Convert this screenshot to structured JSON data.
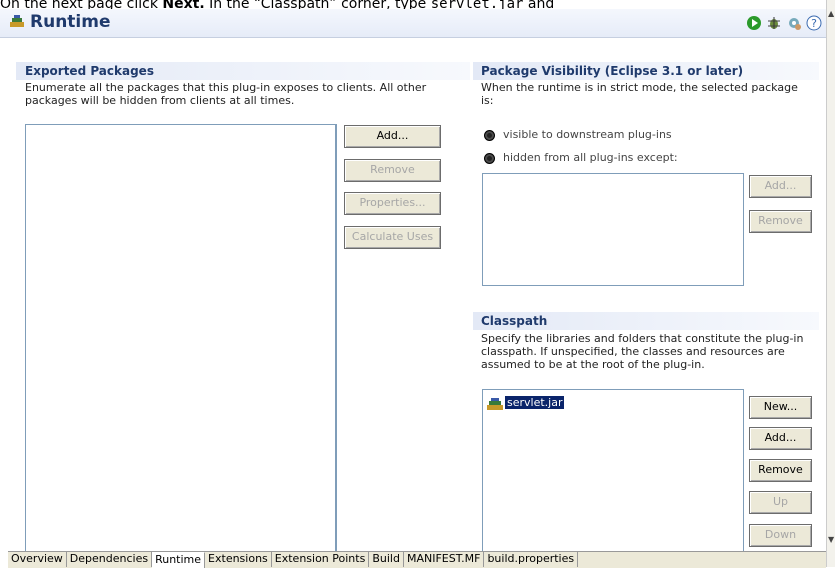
{
  "caption": {
    "prefix": "On the next page click ",
    "bold": "Next.",
    "middle": " In the “Classpath” corner, type ",
    "mono": "servlet.jar",
    "suffix": " and"
  },
  "header": {
    "title": "Runtime",
    "icons": [
      "run-icon",
      "debug-icon",
      "external-tools-icon",
      "help-icon"
    ]
  },
  "exported": {
    "title": "Exported Packages",
    "desc1": "Enumerate all the packages that this plug-in exposes to clients.  All other",
    "desc2": "packages will be hidden from clients at all times.",
    "buttons": {
      "add": "Add...",
      "remove": "Remove",
      "properties": "Properties...",
      "calculate": "Calculate Uses"
    }
  },
  "visibility": {
    "title": "Package Visibility (Eclipse 3.1 or later)",
    "desc1": "When the runtime is in strict mode, the selected package",
    "desc2": "is:",
    "option1": "visible to downstream plug-ins",
    "option2": "hidden from all plug-ins except:",
    "buttons": {
      "add": "Add...",
      "remove": "Remove"
    }
  },
  "classpath": {
    "title": "Classpath",
    "desc1": "Specify the libraries and folders that constitute the plug-in",
    "desc2": "classpath.  If unspecified, the classes and resources are",
    "desc3": "assumed to be at the root of the plug-in.",
    "items": [
      "servlet.jar"
    ],
    "buttons": {
      "new": "New...",
      "add": "Add...",
      "remove": "Remove",
      "up": "Up",
      "down": "Down"
    }
  },
  "tabs": [
    "Overview",
    "Dependencies",
    "Runtime",
    "Extensions",
    "Extension Points",
    "Build",
    "MANIFEST.MF",
    "build.properties"
  ],
  "active_tab": "Runtime"
}
